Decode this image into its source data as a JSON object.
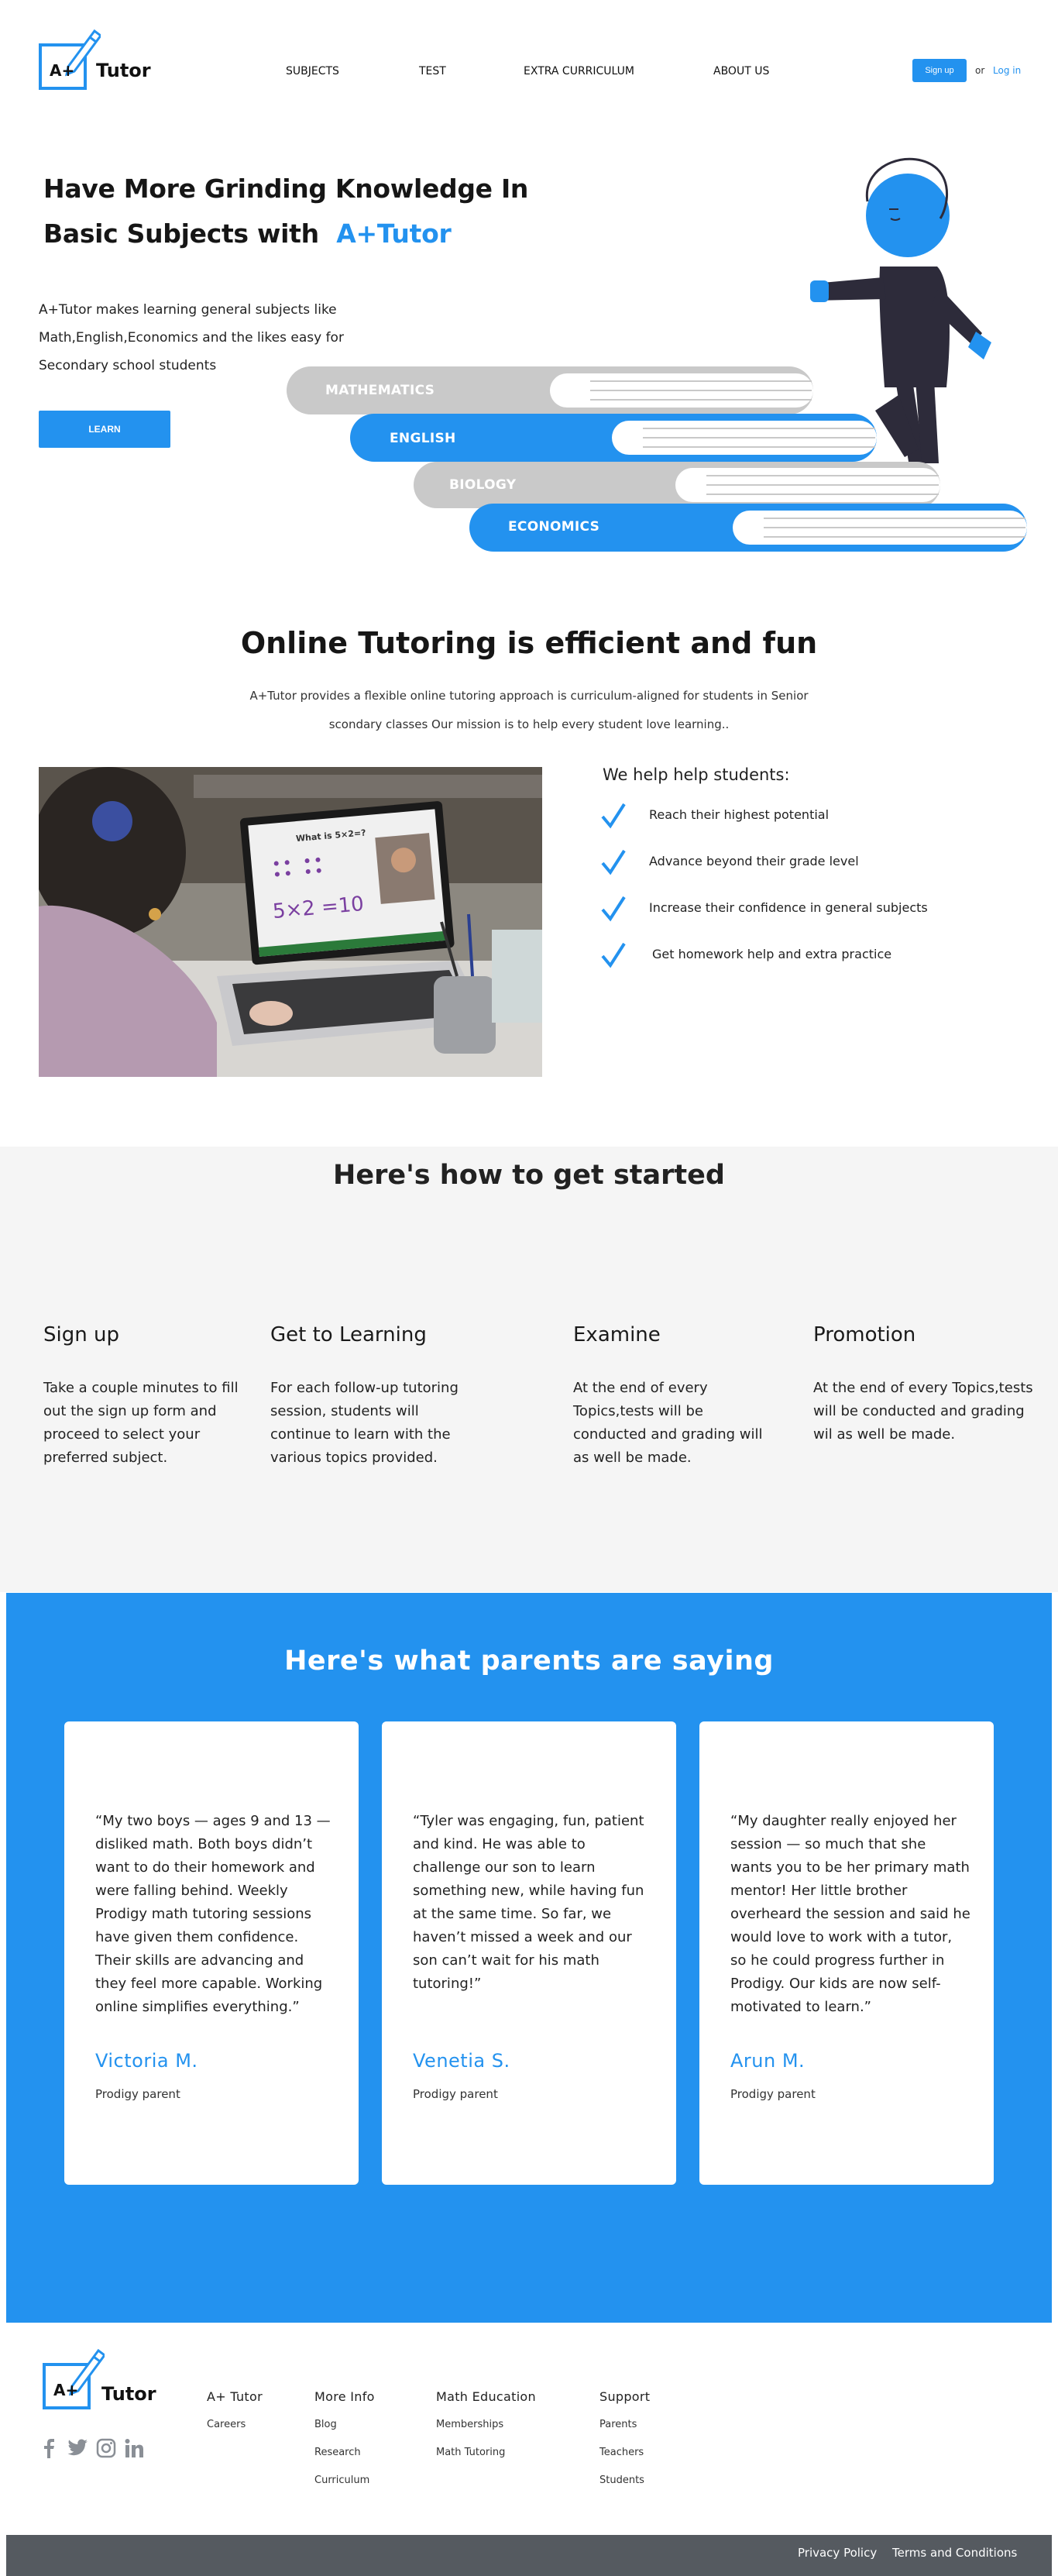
{
  "header": {
    "logo_mark": "A+",
    "logo_text": "Tutor",
    "nav": [
      "SUBJECTS",
      "TEST",
      "EXTRA CURRICULUM",
      "ABOUT US"
    ],
    "signup_label": "Sign up",
    "or_label": "or",
    "login_label": "Log in"
  },
  "hero": {
    "title_line1": "Have More Grinding Knowledge In",
    "title_line2": "Basic Subjects with",
    "title_brand": "A+Tutor",
    "description": "A+Tutor makes learning general subjects like Math,English,Economics and the likes easy for Secondary school students",
    "learn_label": "LEARN",
    "books": [
      "MATHEMATICS",
      "ENGLISH",
      "BIOLOGY",
      "ECONOMICS"
    ]
  },
  "online": {
    "title": "Online Tutoring is efficient and fun",
    "description_line1": "A+Tutor provides a flexible online tutoring approach is curriculum-aligned for students in Senior",
    "description_line2": "scondary classes  Our mission is to help every student love learning..",
    "photo_board_text": "What is 5×2=?",
    "photo_equation": "5×2 =10",
    "help_title": "We help help students:",
    "help_items": [
      "Reach their highest potential",
      "Advance beyond their grade level",
      "Increase their confidence in general subjects",
      "Get homework help and extra practice"
    ]
  },
  "steps": {
    "title": "Here's how to get started",
    "items": [
      {
        "title": "Sign up",
        "lines": [
          "Take a couple minutes to fill",
          "out the sign up form and",
          "proceed to select your",
          "preferred subject."
        ]
      },
      {
        "title": "Get to Learning",
        "lines": [
          "For each follow-up tutoring",
          "session, students will",
          "continue to learn with the",
          "various topics provided."
        ]
      },
      {
        "title": "Examine",
        "lines": [
          "At the end of every",
          "Topics,tests will be",
          "conducted and grading will",
          "as well be made."
        ]
      },
      {
        "title": "Promotion",
        "lines": [
          "At the end of every Topics,tests",
          "will be conducted and grading",
          "wil as well be made."
        ]
      }
    ]
  },
  "testimonials": {
    "title": "Here's what parents are saying",
    "items": [
      {
        "quote": "“My two boys — ages 9 and 13 — disliked math. Both boys didn’t want to do their homework and were falling behind. Weekly Prodigy math tutoring sessions have given them confidence. Their skills are advancing and they feel more capable. Working online simplifies everything.”",
        "name": "Victoria M.",
        "role": "Prodigy parent"
      },
      {
        "quote": "“Tyler was engaging, fun, patient and kind. He was able to challenge our son to learn something new, while having fun at the same time. So far, we haven’t missed a week and our son can’t wait for his math tutoring!”",
        "name": "Venetia S.",
        "role": "Prodigy parent"
      },
      {
        "quote": "“My daughter really enjoyed her session — so much that she wants you to be her primary math mentor! Her little brother overheard the session and said he would love to work with a tutor, so he could progress further in Prodigy. Our kids are now self-motivated to learn.”",
        "name": "Arun M.",
        "role": "Prodigy parent"
      }
    ]
  },
  "footer": {
    "logo_mark": "A+",
    "logo_text": "Tutor",
    "social_icons": [
      "facebook-icon",
      "twitter-icon",
      "instagram-icon",
      "linkedin-icon"
    ],
    "columns": [
      {
        "title": "A+ Tutor",
        "links": [
          "Careers"
        ]
      },
      {
        "title": "More Info",
        "links": [
          "Blog",
          "Research",
          "Curriculum"
        ]
      },
      {
        "title": "Math Education",
        "links": [
          "Memberships",
          "Math Tutoring"
        ]
      },
      {
        "title": "Support",
        "links": [
          "Parents",
          "Teachers",
          "Students"
        ]
      }
    ],
    "privacy_label": "Privacy Policy",
    "terms_label": "Terms and Conditions"
  },
  "colors": {
    "accent": "#2392ef",
    "dark_figure": "#2d2b3a",
    "grey_book": "#c9c9c9",
    "section_bg": "#f5f5f5",
    "bottom_bar": "#555a60"
  }
}
